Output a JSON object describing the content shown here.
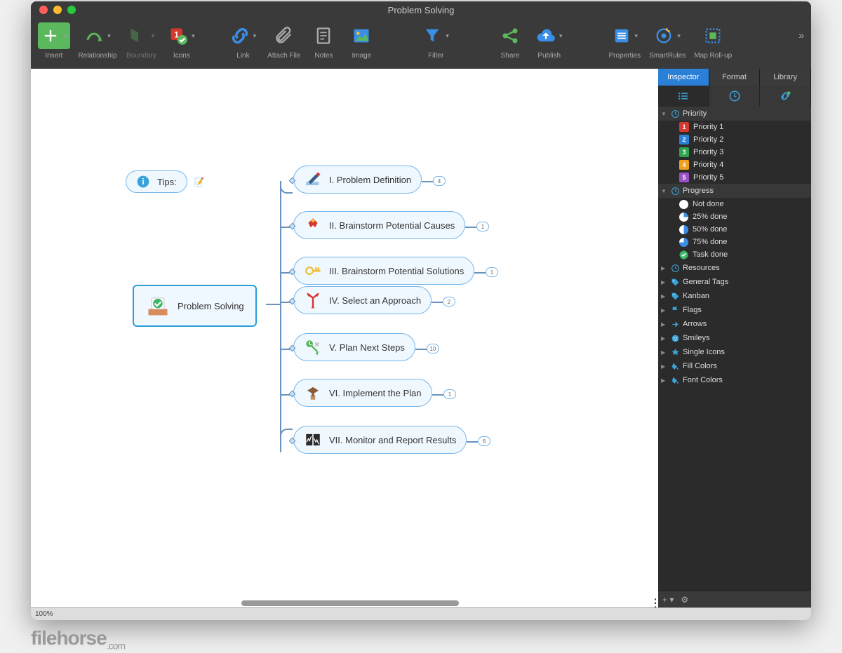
{
  "window": {
    "title": "Problem Solving"
  },
  "toolbar": {
    "insert": "Insert",
    "relationship": "Relationship",
    "boundary": "Boundary",
    "icons": "Icons",
    "link": "Link",
    "attach": "Attach File",
    "notes": "Notes",
    "image": "Image",
    "filter": "Filter",
    "share": "Share",
    "publish": "Publish",
    "properties": "Properties",
    "smartrules": "SmartRules",
    "maprollup": "Map Roll-up"
  },
  "sidebar": {
    "tabs": {
      "inspector": "Inspector",
      "format": "Format",
      "library": "Library"
    },
    "priority": {
      "label": "Priority",
      "items": [
        "Priority 1",
        "Priority 2",
        "Priority 3",
        "Priority 4",
        "Priority 5"
      ],
      "colors": [
        "#d6382f",
        "#2a7fd6",
        "#2ea44f",
        "#f0a020",
        "#9b4fc7"
      ]
    },
    "progress": {
      "label": "Progress",
      "items": [
        "Not done",
        "25% done",
        "50% done",
        "75% done",
        "Task done"
      ]
    },
    "cats": [
      "Resources",
      "General Tags",
      "Kanban",
      "Flags",
      "Arrows",
      "Smileys",
      "Single Icons",
      "Fill Colors",
      "Font Colors"
    ]
  },
  "map": {
    "root": "Problem Solving",
    "tips": "Tips:",
    "nodes": [
      {
        "label": "I.  Problem Definition",
        "count": "4"
      },
      {
        "label": "II.  Brainstorm Potential Causes",
        "count": "1"
      },
      {
        "label": "III.  Brainstorm Potential Solutions",
        "count": "1"
      },
      {
        "label": "IV.  Select an Approach",
        "count": "2"
      },
      {
        "label": "V.  Plan Next Steps",
        "count": "10"
      },
      {
        "label": "VI.  Implement the Plan",
        "count": "1"
      },
      {
        "label": "VII.  Monitor and Report Results",
        "count": "6"
      }
    ]
  },
  "status": {
    "zoom": "100%"
  },
  "watermark": "filehorse",
  "watermark_suffix": ".com"
}
